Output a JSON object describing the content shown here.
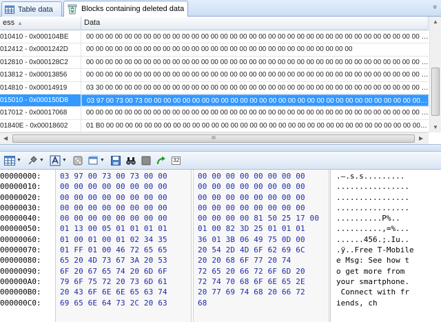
{
  "tabs": [
    {
      "label": "Table data",
      "icon": "table-icon",
      "active": false
    },
    {
      "label": "Blocks containing deleted data",
      "icon": "recycle-bin-icon",
      "active": true
    }
  ],
  "tab_overflow_glyph": "»",
  "grid": {
    "columns": [
      "ess",
      "Data"
    ],
    "rows": [
      {
        "address": "010410 - 0x000104BE",
        "data": "00 00 00 00 00 00 00 00 00 00 00 00 00 00 00 00 00 00 00 00 00 00 00 00 00 00 00 00 00 00 00 00 00 00 00 00 00 00 00 00 00 ...",
        "selected": false
      },
      {
        "address": "012412 - 0x0001242D",
        "data": "00 00 00 00 00 00 00 00 00 00 00 00 00 00 00 00 00 00 00 00 00 00 00 00 00 00 00 00",
        "selected": false
      },
      {
        "address": "012810 - 0x000128C2",
        "data": "00 00 00 00 00 00 00 00 00 00 00 00 00 00 00 00 00 00 00 00 00 00 00 00 00 00 00 00 00 00 00 00 00 00 00 00 00 00 00 00 00 ...",
        "selected": false
      },
      {
        "address": "013812 - 0x00013856",
        "data": "00 00 00 00 00 00 00 00 00 00 00 00 00 00 00 00 00 00 00 00 00 00 00 00 00 00 00 00 00 00 00 00 00 00 00 00 00 00 00 00 00 ...",
        "selected": false
      },
      {
        "address": "014810 - 0x00014919",
        "data": "03 30 00 00 00 00 00 00 00 00 00 00 00 00 00 00 00 00 00 00 00 00 00 00 00 00 00 00 00 00 00 00 00 00 00 00 00 00 00 00 00 ...",
        "selected": false
      },
      {
        "address": "015010 - 0x000150D8",
        "data": "03 97 00 73 00 73 00 00 00 00 00 00 00 00 00 00 00 00 00 00 00 00 00 00 00 00 00 00 00 00 00 00 00 00 00 00 00 00 00 00 0...",
        "selected": true
      },
      {
        "address": "017012 - 0x00017068",
        "data": "00 00 00 00 00 00 00 00 00 00 00 00 00 00 00 00 00 00 00 00 00 00 00 00 00 00 00 00 00 00 00 00 00 00 00 00 00 00 00 00 00 ...",
        "selected": false
      },
      {
        "address": "01840E - 0x00018602",
        "data": "01 B0 00 00 00 00 00 00 00 00 00 00 00 00 00 00 00 00 00 00 00 00 00 00 00 00 00 00 00 00 00 00 00 00 00 00 00 00 00 00 00 ...",
        "selected": false
      }
    ],
    "hscroll_grip": "III"
  },
  "toolbar": {
    "items": [
      "grid-view-icon",
      "pin-icon",
      "text-format-icon",
      "dice-icon",
      "window-icon",
      "save-icon",
      "binoculars-find-icon",
      "gray-box-icon",
      "go-arrow-icon",
      "bits-32-icon"
    ],
    "bits_label": "32"
  },
  "hex": {
    "offsets": [
      "00000000:",
      "00000010:",
      "00000020:",
      "00000030:",
      "00000040:",
      "00000050:",
      "00000060:",
      "00000070:",
      "00000080:",
      "00000090:",
      "000000A0:",
      "000000B0:",
      "000000C0:"
    ],
    "left": [
      "03 97 00 73 00 73 00 00",
      "00 00 00 00 00 00 00 00",
      "00 00 00 00 00 00 00 00",
      "00 00 00 00 00 00 00 00",
      "00 00 00 00 00 00 00 00",
      "01 13 00 05 01 01 01 01",
      "01 00 01 00 01 02 34 35",
      "01 FF 01 00 46 72 65 65",
      "65 20 4D 73 67 3A 20 53",
      "6F 20 67 65 74 20 6D 6F",
      "79 6F 75 72 20 73 6D 61",
      "20 43 6F 6E 6E 65 63 74",
      "69 65 6E 64 73 2C 20 63"
    ],
    "right": [
      "00 00 00 00 00 00 00 00",
      "00 00 00 00 00 00 00 00",
      "00 00 00 00 00 00 00 00",
      "00 00 00 00 00 00 00 00",
      "00 00 00 00 81 50 25 17 00",
      "01 00 82 3D 25 01 01 01",
      "36 01 3B 06 49 75 0D 00",
      "20 54 2D 4D 6F 62 69 6C",
      "20 20 68 6F 77 20 74",
      "72 65 20 66 72 6F 6D 20",
      "72 74 70 68 6F 6E 65 2E",
      "20 77 69 74 68 20 66 72",
      "68"
    ],
    "ascii": [
      ".—.s.s.........",
      "................",
      "................",
      "................",
      "..........P%..",
      "..........,=%...",
      "......456.;.Iu..",
      ".ÿ..Free T-Mobile",
      "e Msg: See how t",
      "o get more from",
      "your smartphone.",
      " Connect with fr",
      "iends, ch"
    ]
  }
}
